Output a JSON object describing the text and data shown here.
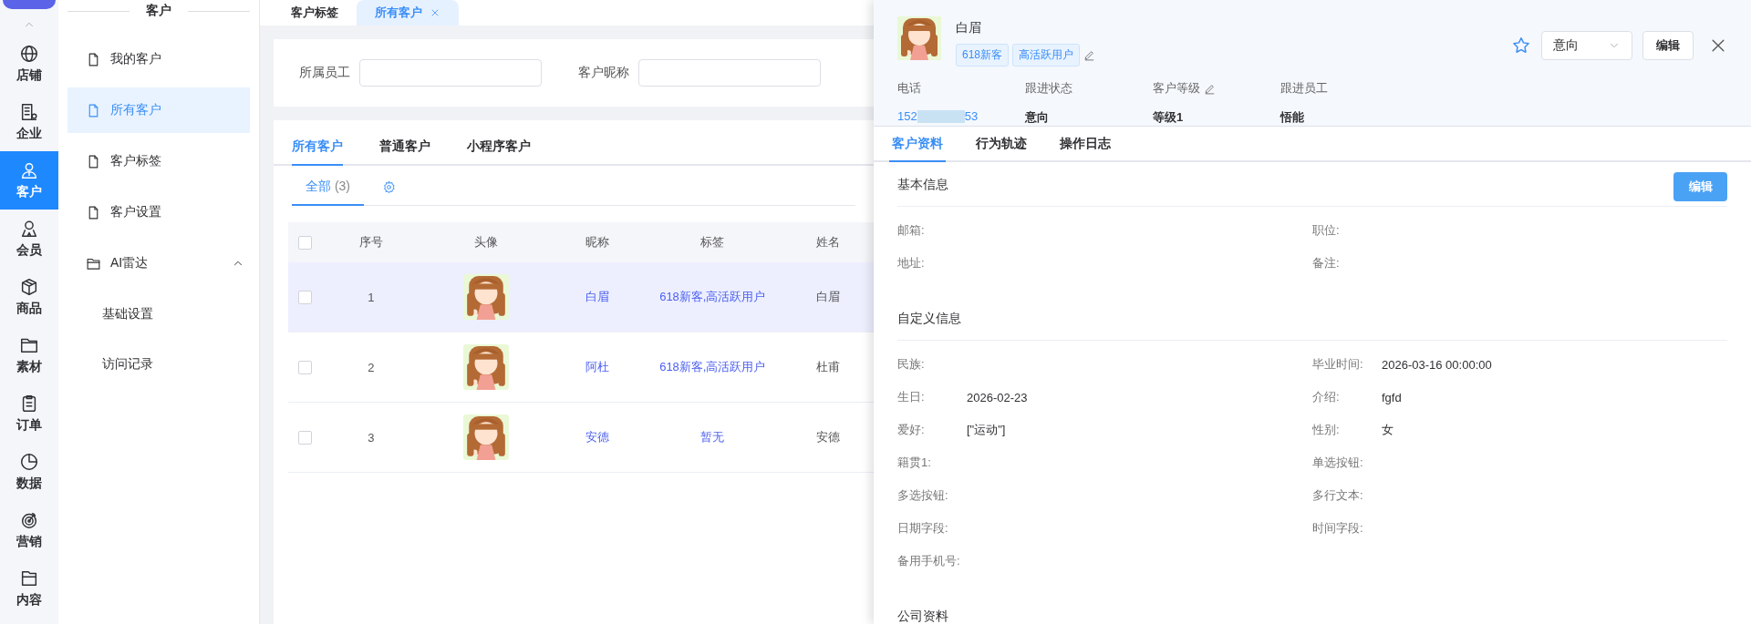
{
  "nav": {
    "items": [
      {
        "label": "店铺",
        "selected": false
      },
      {
        "label": "企业",
        "selected": false
      },
      {
        "label": "客户",
        "selected": true
      },
      {
        "label": "会员",
        "selected": false
      },
      {
        "label": "商品",
        "selected": false
      },
      {
        "label": "素材",
        "selected": false
      },
      {
        "label": "订单",
        "selected": false
      },
      {
        "label": "数据",
        "selected": false
      },
      {
        "label": "营销",
        "selected": false
      },
      {
        "label": "内容",
        "selected": false
      }
    ]
  },
  "submenu": {
    "title": "客户",
    "items": [
      {
        "kind": "page",
        "label": "我的客户",
        "selected": false
      },
      {
        "kind": "page",
        "label": "所有客户",
        "selected": true
      },
      {
        "kind": "page",
        "label": "客户标签",
        "selected": false
      },
      {
        "kind": "page",
        "label": "客户设置",
        "selected": false
      },
      {
        "kind": "group",
        "label": "AI雷达",
        "expanded": true,
        "children": [
          {
            "label": "基础设置",
            "selected": false
          },
          {
            "label": "访问记录",
            "selected": false
          }
        ]
      }
    ]
  },
  "page_tabs": [
    {
      "label": "客户标签",
      "selected": false,
      "closable": false
    },
    {
      "label": "所有客户",
      "selected": true,
      "closable": true
    }
  ],
  "filters": [
    {
      "label": "所属员工"
    },
    {
      "label": "客户昵称"
    }
  ],
  "customer_tabs": [
    {
      "label": "所有客户",
      "selected": true
    },
    {
      "label": "普通客户",
      "selected": false
    },
    {
      "label": "小程序客户",
      "selected": false
    }
  ],
  "sub_tabs": [
    {
      "label": "全部",
      "count": "(3)",
      "selected": true
    }
  ],
  "table": {
    "all_checked": false,
    "columns": [
      "序号",
      "头像",
      "昵称",
      "标签",
      "姓名"
    ],
    "rows": [
      {
        "checked": false,
        "selected": true,
        "index": "1",
        "nickname": "白眉",
        "tags": "618新客,高活跃用户",
        "name": "白眉"
      },
      {
        "checked": false,
        "selected": false,
        "index": "2",
        "nickname": "阿杜",
        "tags": "618新客,高活跃用户",
        "name": "杜甫"
      },
      {
        "checked": false,
        "selected": false,
        "index": "3",
        "nickname": "安德",
        "tags": "暂无",
        "name": "安德"
      }
    ]
  },
  "drawer": {
    "name": "白眉",
    "tags": [
      "618新客",
      "高活跃用户"
    ],
    "starred": false,
    "status_select": "意向",
    "edit_button": "编辑",
    "summary": [
      {
        "kind": "phone",
        "label": "电话",
        "value_start": "152",
        "value_end": "53",
        "editable": false
      },
      {
        "kind": "text",
        "label": "跟进状态",
        "value": "意向",
        "editable": false
      },
      {
        "kind": "text",
        "label": "客户等级",
        "value": "等级1",
        "editable": true
      },
      {
        "kind": "text",
        "label": "跟进员工",
        "value": "悟能",
        "editable": false
      }
    ],
    "tabs": [
      {
        "label": "客户资料",
        "selected": true
      },
      {
        "label": "行为轨迹",
        "selected": false
      },
      {
        "label": "操作日志",
        "selected": false
      }
    ],
    "sections": [
      {
        "title": "基本信息",
        "button": "编辑",
        "fields": [
          {
            "label": "邮箱:"
          },
          {
            "label": "职位:"
          },
          {
            "label": "地址:"
          },
          {
            "label": "备注:"
          }
        ]
      },
      {
        "title": "自定义信息",
        "fields": [
          {
            "label": "民族:"
          },
          {
            "label": "毕业时间:",
            "value": "2026-03-16 00:00:00"
          },
          {
            "label": "生日:",
            "value": "2026-02-23"
          },
          {
            "label": "介绍:",
            "value": "fgfd"
          },
          {
            "label": "爱好:",
            "value": "[\"运动\"]"
          },
          {
            "label": "性别:",
            "value": "女"
          },
          {
            "label": "籍贯1:"
          },
          {
            "label": "单选按钮:"
          },
          {
            "label": "多选按钮:"
          },
          {
            "label": "多行文本:"
          },
          {
            "label": "日期字段:"
          },
          {
            "label": "时间字段:"
          },
          {
            "label": "备用手机号:"
          }
        ]
      },
      {
        "title": "公司资料"
      }
    ]
  }
}
